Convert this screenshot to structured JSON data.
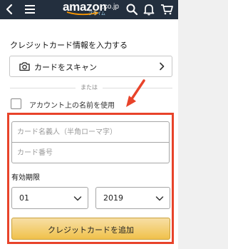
{
  "header": {
    "logo_text": "amazon",
    "logo_tld": ".co.jp",
    "logo_sub": "プライム"
  },
  "form": {
    "section_title": "クレジットカード情報を入力する",
    "scan_button_label": "カードをスキャン",
    "divider_text": "または",
    "use_account_name_label": "アカウント上の名前を使用",
    "use_account_name_checked": false,
    "cardholder_placeholder": "カード名義人（半角ローマ字）",
    "card_number_placeholder": "カード番号",
    "expiry_label": "有効期限",
    "expiry_month": "01",
    "expiry_year": "2019",
    "submit_label": "クレジットカードを追加"
  },
  "colors": {
    "header_bg": "#232f3e",
    "highlight": "#e8432a",
    "button_bg": "#f0c14b"
  }
}
